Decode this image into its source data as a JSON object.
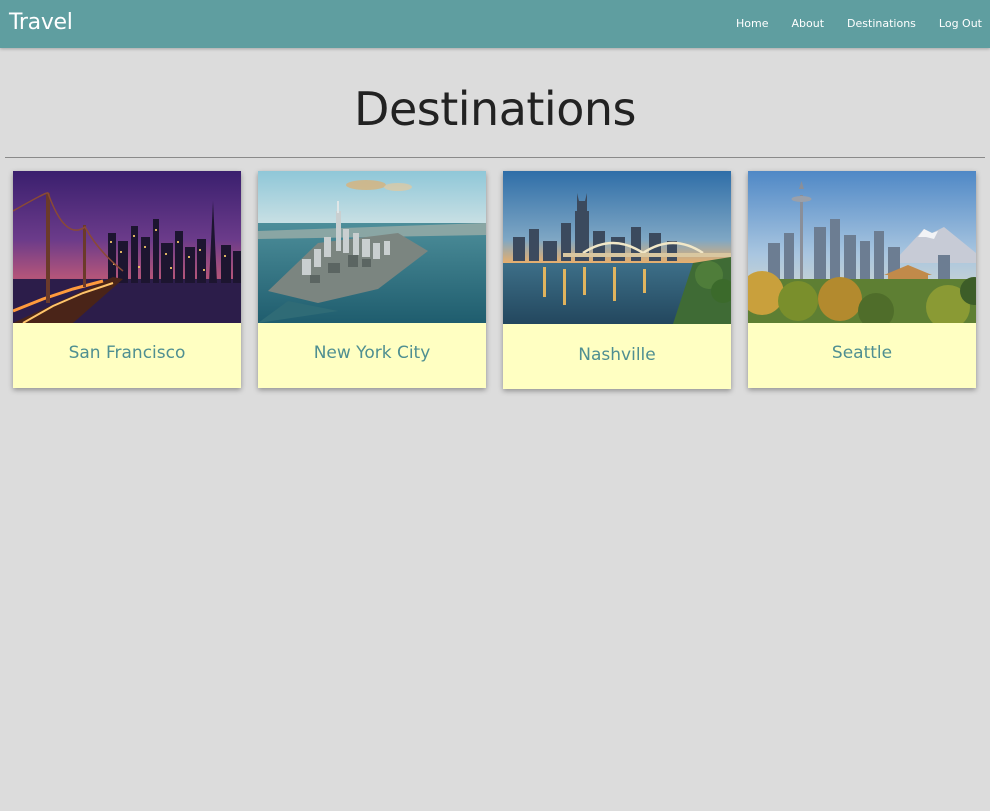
{
  "navbar": {
    "brand": "Travel",
    "links": [
      "Home",
      "About",
      "Destinations",
      "Log Out"
    ],
    "background": "#5f9ea0"
  },
  "page": {
    "title": "Destinations",
    "background": "#dcdcdc"
  },
  "cards": [
    {
      "label": "San Francisco",
      "image": "golden-gate-bridge-night-skyline"
    },
    {
      "label": "New York City",
      "image": "manhattan-aerial-view"
    },
    {
      "label": "Nashville",
      "image": "nashville-skyline-river-bridge"
    },
    {
      "label": "Seattle",
      "image": "seattle-space-needle-mount-rainier"
    }
  ],
  "colors": {
    "card_background": "#ffffc2",
    "card_label": "#4f8f91"
  }
}
